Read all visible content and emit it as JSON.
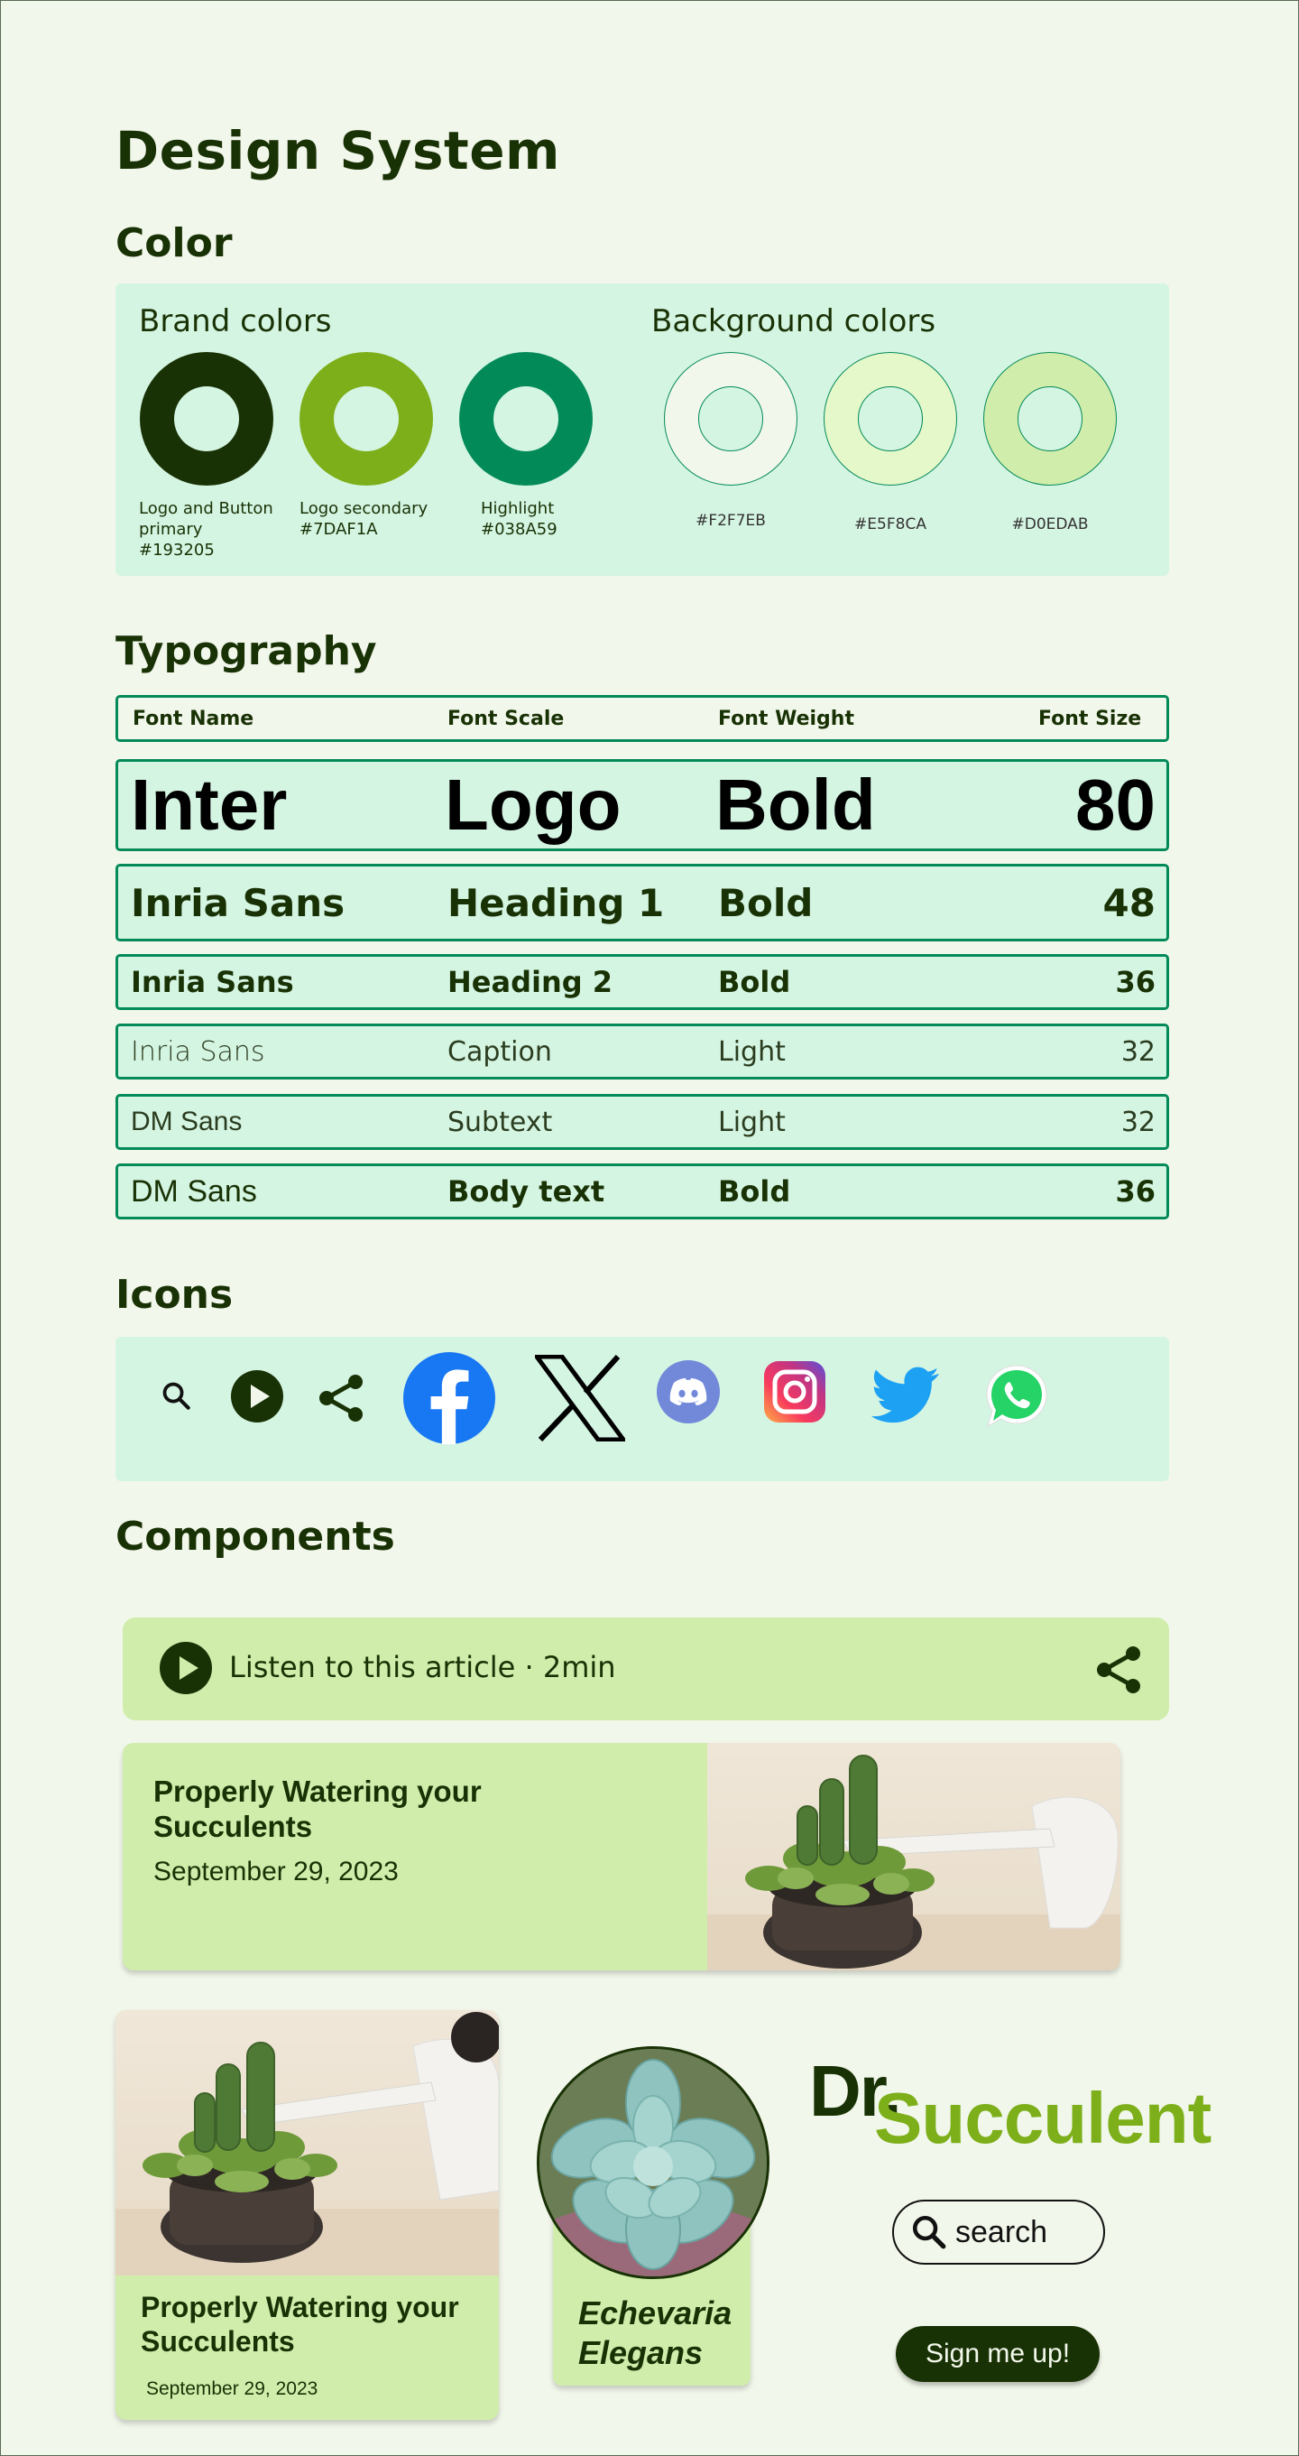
{
  "page": {
    "title": "Design System"
  },
  "color": {
    "heading": "Color",
    "brand_title": "Brand colors",
    "background_title": "Background colors",
    "brand": [
      {
        "label": "Logo and Button primary",
        "hex": "#193205",
        "color": "#193205"
      },
      {
        "label": "Logo secondary",
        "hex": "#7DAF1A",
        "color": "#7DAF1A"
      },
      {
        "label": "Highlight",
        "hex": "#038A59",
        "color": "#038A59"
      }
    ],
    "background": [
      {
        "hex": "#F2F7EB",
        "color": "#F2F7EB"
      },
      {
        "hex": "#E5F8CA",
        "color": "#E5F8CA"
      },
      {
        "hex": "#D0EDAB",
        "color": "#D0EDAB"
      }
    ]
  },
  "typography": {
    "heading": "Typography",
    "columns": [
      "Font Name",
      "Font Scale",
      "Font Weight",
      "Font Size"
    ],
    "rows": [
      {
        "name": "Inter",
        "scale": "Logo",
        "weight": "Bold",
        "size": "80"
      },
      {
        "name": "Inria Sans",
        "scale": "Heading 1",
        "weight": "Bold",
        "size": "48"
      },
      {
        "name": "Inria Sans",
        "scale": "Heading 2",
        "weight": "Bold",
        "size": "36"
      },
      {
        "name": "Inria Sans",
        "scale": "Caption",
        "weight": "Light",
        "size": "32"
      },
      {
        "name": "DM Sans",
        "scale": "Subtext",
        "weight": "Light",
        "size": "32"
      },
      {
        "name": "DM Sans",
        "scale": "Body text",
        "weight": "Bold",
        "size": "36"
      }
    ]
  },
  "icons": {
    "heading": "Icons",
    "items": [
      "search-icon",
      "play-icon",
      "share-icon",
      "facebook-icon",
      "x-icon",
      "discord-icon",
      "instagram-icon",
      "twitter-icon",
      "whatsapp-icon"
    ]
  },
  "components": {
    "heading": "Components",
    "audio_bar": {
      "label": "Listen to this article · 2min"
    },
    "article_card_wide": {
      "title": "Properly Watering your Succulents",
      "date": "September 29, 2023"
    },
    "article_card_tall": {
      "title": "Properly Watering your Succulents",
      "date": "September 29, 2023"
    },
    "plant_card": {
      "name": "Echevaria Elegans"
    },
    "logo": {
      "part1": "Dr.",
      "part2": "Succulent"
    },
    "search": {
      "label": "search"
    },
    "signup_button": {
      "label": "Sign me up!"
    }
  },
  "colors": {
    "primary": "#193205",
    "secondary": "#7DAF1A",
    "highlight": "#038A59",
    "panel": "#D5F5E3",
    "card": "#D0EDAB"
  }
}
